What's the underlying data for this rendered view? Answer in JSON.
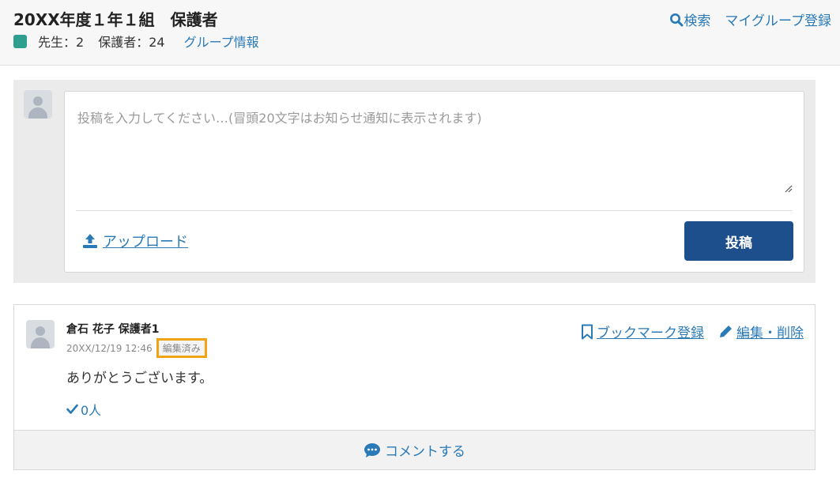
{
  "header": {
    "group_title": "20XX年度１年１組　保護者",
    "teacher_count": "先生：2",
    "guardian_count": "保護者：24",
    "group_info_link": "グループ情報",
    "group_color": "#2e9e8f",
    "search_label": "検索",
    "search_icon": "search-icon",
    "my_group_register": "マイグループ登録"
  },
  "compose": {
    "placeholder": "投稿を入力してください…(冒頭20文字はお知らせ通知に表示されます)",
    "upload_label": "アップロード",
    "upload_icon": "upload-icon",
    "submit_label": "投稿"
  },
  "post": {
    "author": "倉石 花子 保護者1",
    "timestamp": "20XX/12/19 12:46",
    "edited_badge": "編集済み",
    "body": "ありがとうございます。",
    "like_count": "0人",
    "bookmark_label": "ブックマーク登録",
    "edit_delete_label": "編集・削除",
    "comment_label": "コメントする"
  },
  "colors": {
    "accent_link": "#2a7ab8",
    "primary_button": "#1d4f8d",
    "highlight_border": "#f0a413"
  }
}
